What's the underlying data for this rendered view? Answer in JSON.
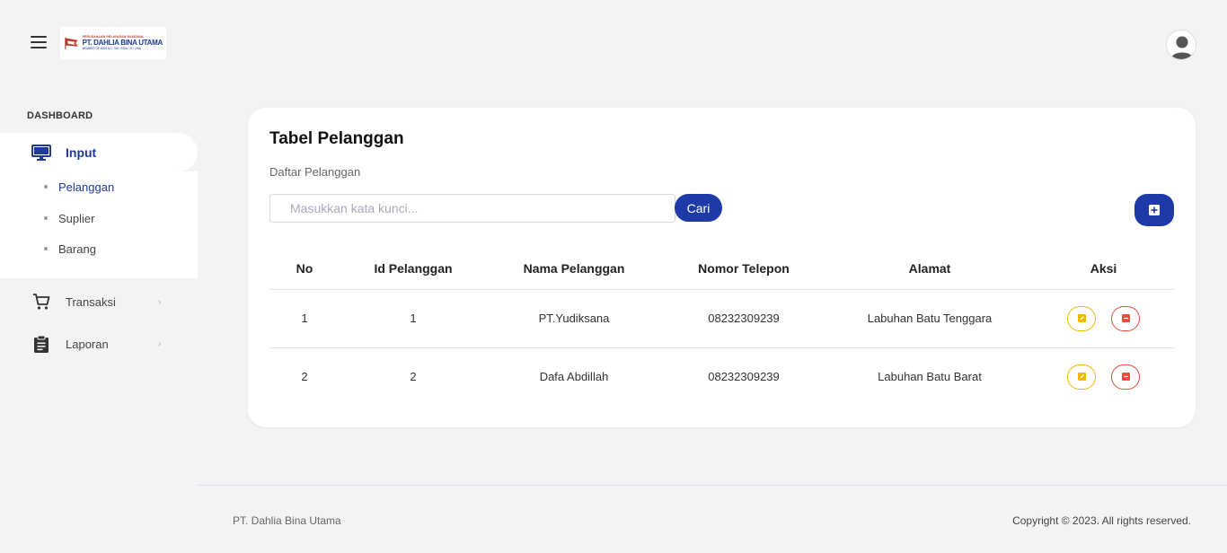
{
  "header": {
    "logo": {
      "subtitle": "PERUSAHAAN PELAYARAN NASIONAL",
      "name": "PT. DAHLIA BINA UTAMA",
      "member": "MEMBER OF INSA NO. 766 / INSA / XI / 1994"
    }
  },
  "sidebar": {
    "heading": "DASHBOARD",
    "input_label": "Input",
    "submenu": [
      {
        "label": "Pelanggan"
      },
      {
        "label": "Suplier"
      },
      {
        "label": "Barang"
      }
    ],
    "transaksi_label": "Transaksi",
    "laporan_label": "Laporan"
  },
  "main": {
    "title": "Tabel Pelanggan",
    "subtitle": "Daftar Pelanggan",
    "search_placeholder": "Masukkan kata kunci...",
    "search_button": "Cari",
    "table": {
      "columns": [
        "No",
        "Id Pelanggan",
        "Nama Pelanggan",
        "Nomor Telepon",
        "Alamat",
        "Aksi"
      ],
      "rows": [
        [
          "1",
          "1",
          "PT.Yudiksana",
          "08232309239",
          "Labuhan Batu Tenggara"
        ],
        [
          "2",
          "2",
          "Dafa Abdillah",
          "08232309239",
          "Labuhan Batu Barat"
        ]
      ]
    }
  },
  "footer": {
    "left": "PT. Dahlia Bina Utama",
    "right": "Copyright © 2023. All rights reserved."
  },
  "colors": {
    "primary": "#1e3aa8",
    "edit": "#f5b800",
    "delete": "#e74c3c",
    "background": "#f2f3f5"
  },
  "icons": [
    "menu-icon",
    "monitor-icon",
    "cart-icon",
    "clipboard-icon",
    "chevron-right-icon",
    "plus-square-icon",
    "edit-icon",
    "delete-icon",
    "user-avatar-icon"
  ]
}
